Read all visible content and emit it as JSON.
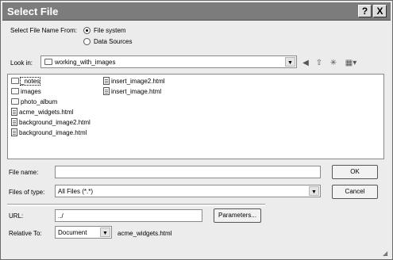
{
  "window": {
    "title": "Select File",
    "help_label": "?",
    "close_label": "X"
  },
  "select_from": {
    "label": "Select File Name From:",
    "options": [
      {
        "label": "File system",
        "selected": true
      },
      {
        "label": "Data Sources",
        "selected": false
      }
    ]
  },
  "look_in": {
    "label": "Look in:",
    "value": "working_with_images"
  },
  "toolbar": {
    "icons": [
      "back-icon",
      "up-folder-icon",
      "new-folder-icon",
      "view-menu-icon"
    ]
  },
  "files": {
    "column1": [
      {
        "name": "_notes",
        "type": "folder"
      },
      {
        "name": "images",
        "type": "folder"
      },
      {
        "name": "photo_album",
        "type": "folder"
      },
      {
        "name": "acme_widgets.html",
        "type": "html"
      },
      {
        "name": "background_image2.html",
        "type": "html"
      },
      {
        "name": "background_image.html",
        "type": "html"
      }
    ],
    "column2": [
      {
        "name": "insert_image2.html",
        "type": "html"
      },
      {
        "name": "insert_image.html",
        "type": "html"
      }
    ]
  },
  "file_name": {
    "label": "File name:",
    "value": ""
  },
  "files_of_type": {
    "label": "Files of type:",
    "value": "All Files (*.*)"
  },
  "buttons": {
    "ok": "OK",
    "cancel": "Cancel",
    "parameters": "Parameters..."
  },
  "url": {
    "label": "URL:",
    "value": "../"
  },
  "relative_to": {
    "label": "Relative To:",
    "value": "Document",
    "file": "acme_widgets.html"
  }
}
